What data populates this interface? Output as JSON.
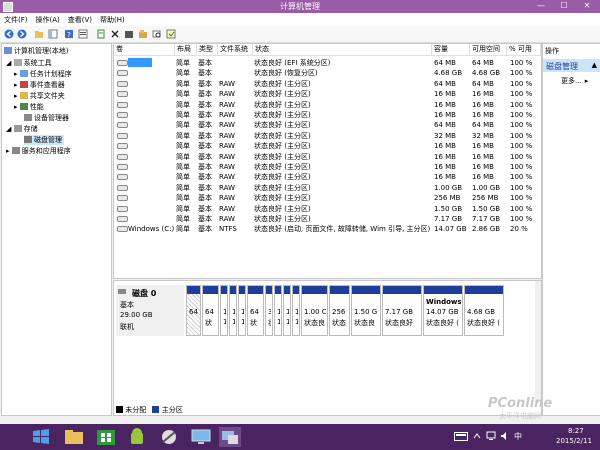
{
  "window": {
    "title": "计算机管理"
  },
  "menu": [
    "文件(F)",
    "操作(A)",
    "查看(V)",
    "帮助(H)"
  ],
  "tree": {
    "root": "计算机管理(本地)",
    "items": [
      {
        "label": "系统工具",
        "level": 1
      },
      {
        "label": "任务计划程序",
        "level": 2
      },
      {
        "label": "事件查看器",
        "level": 2
      },
      {
        "label": "共享文件夹",
        "level": 2
      },
      {
        "label": "性能",
        "level": 2
      },
      {
        "label": "设备管理器",
        "level": 2
      },
      {
        "label": "存储",
        "level": 1
      },
      {
        "label": "磁盘管理",
        "level": 2
      },
      {
        "label": "服务和应用程序",
        "level": 1
      }
    ]
  },
  "volumes": {
    "headers": [
      "卷",
      "布局",
      "类型",
      "文件系统",
      "状态",
      "容量",
      "可用空间",
      "% 可用"
    ],
    "rows": [
      {
        "vol": "",
        "layout": "简单",
        "type": "基本",
        "fs": "",
        "status": "状态良好 (EFI 系统分区)",
        "cap": "64 MB",
        "free": "64 MB",
        "pct": "100 %",
        "selected": true
      },
      {
        "vol": "",
        "layout": "简单",
        "type": "基本",
        "fs": "",
        "status": "状态良好 (恢复分区)",
        "cap": "4.68 GB",
        "free": "4.68 GB",
        "pct": "100 %"
      },
      {
        "vol": "",
        "layout": "简单",
        "type": "基本",
        "fs": "RAW",
        "status": "状态良好 (主分区)",
        "cap": "64 MB",
        "free": "64 MB",
        "pct": "100 %"
      },
      {
        "vol": "",
        "layout": "简单",
        "type": "基本",
        "fs": "RAW",
        "status": "状态良好 (主分区)",
        "cap": "16 MB",
        "free": "16 MB",
        "pct": "100 %"
      },
      {
        "vol": "",
        "layout": "简单",
        "type": "基本",
        "fs": "RAW",
        "status": "状态良好 (主分区)",
        "cap": "16 MB",
        "free": "16 MB",
        "pct": "100 %"
      },
      {
        "vol": "",
        "layout": "简单",
        "type": "基本",
        "fs": "RAW",
        "status": "状态良好 (主分区)",
        "cap": "16 MB",
        "free": "16 MB",
        "pct": "100 %"
      },
      {
        "vol": "",
        "layout": "简单",
        "type": "基本",
        "fs": "RAW",
        "status": "状态良好 (主分区)",
        "cap": "64 MB",
        "free": "64 MB",
        "pct": "100 %"
      },
      {
        "vol": "",
        "layout": "简单",
        "type": "基本",
        "fs": "RAW",
        "status": "状态良好 (主分区)",
        "cap": "32 MB",
        "free": "32 MB",
        "pct": "100 %"
      },
      {
        "vol": "",
        "layout": "简单",
        "type": "基本",
        "fs": "RAW",
        "status": "状态良好 (主分区)",
        "cap": "16 MB",
        "free": "16 MB",
        "pct": "100 %"
      },
      {
        "vol": "",
        "layout": "简单",
        "type": "基本",
        "fs": "RAW",
        "status": "状态良好 (主分区)",
        "cap": "16 MB",
        "free": "16 MB",
        "pct": "100 %"
      },
      {
        "vol": "",
        "layout": "简单",
        "type": "基本",
        "fs": "RAW",
        "status": "状态良好 (主分区)",
        "cap": "16 MB",
        "free": "16 MB",
        "pct": "100 %"
      },
      {
        "vol": "",
        "layout": "简单",
        "type": "基本",
        "fs": "RAW",
        "status": "状态良好 (主分区)",
        "cap": "16 MB",
        "free": "16 MB",
        "pct": "100 %"
      },
      {
        "vol": "",
        "layout": "简单",
        "type": "基本",
        "fs": "RAW",
        "status": "状态良好 (主分区)",
        "cap": "1.00 GB",
        "free": "1.00 GB",
        "pct": "100 %"
      },
      {
        "vol": "",
        "layout": "简单",
        "type": "基本",
        "fs": "RAW",
        "status": "状态良好 (主分区)",
        "cap": "256 MB",
        "free": "256 MB",
        "pct": "100 %"
      },
      {
        "vol": "",
        "layout": "简单",
        "type": "基本",
        "fs": "RAW",
        "status": "状态良好 (主分区)",
        "cap": "1.50 GB",
        "free": "1.50 GB",
        "pct": "100 %"
      },
      {
        "vol": "",
        "layout": "简单",
        "type": "基本",
        "fs": "RAW",
        "status": "状态良好 (主分区)",
        "cap": "7.17 GB",
        "free": "7.17 GB",
        "pct": "100 %"
      },
      {
        "vol": "Windows (C:)",
        "layout": "简单",
        "type": "基本",
        "fs": "NTFS",
        "status": "状态良好 (启动, 页面文件, 故障转储, Wim 引导, 主分区)",
        "cap": "14.07 GB",
        "free": "2.86 GB",
        "pct": "20 %"
      }
    ]
  },
  "actions": {
    "header": "操作",
    "section": "磁盘管理",
    "more": "更多..."
  },
  "disk": {
    "name": "磁盘 0",
    "type": "基本",
    "size": "29.00 GB",
    "state": "联机",
    "partitions": [
      {
        "t1": "64",
        "t2": "",
        "hatched": true
      },
      {
        "t1": "64",
        "t2": "状"
      },
      {
        "t1": "1",
        "t2": "1"
      },
      {
        "t1": "1",
        "t2": "1"
      },
      {
        "t1": "1",
        "t2": "1"
      },
      {
        "t1": "64",
        "t2": "状"
      },
      {
        "t1": "3:",
        "t2": "状"
      },
      {
        "t1": "1",
        "t2": "1"
      },
      {
        "t1": "1",
        "t2": "1"
      },
      {
        "t1": "1",
        "t2": "1"
      },
      {
        "t1": "1.00 C",
        "t2": "状态良"
      },
      {
        "t1": "256",
        "t2": "状态"
      },
      {
        "t1": "1.50 G",
        "t2": "状态良"
      },
      {
        "t1": "7.17 GB",
        "t2": "状态良好"
      },
      {
        "t1": "14.07 GB",
        "t2": "状态良好 (",
        "title": "Windows"
      },
      {
        "t1": "4.68 GB",
        "t2": "状态良好 ("
      }
    ]
  },
  "legend": [
    {
      "label": "未分配",
      "color": "#000000"
    },
    {
      "label": "主分区",
      "color": "#1e3f99"
    }
  ],
  "taskbar": {
    "time": "8:27",
    "date": "2015/2/11",
    "lang": "中"
  },
  "watermark": {
    "text": "PConline",
    "sub": "太平洋电脑网"
  }
}
